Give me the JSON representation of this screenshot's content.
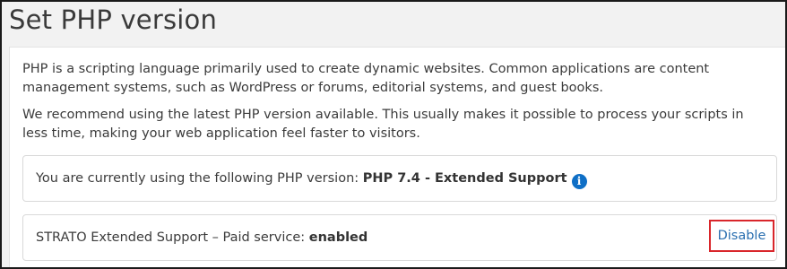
{
  "page": {
    "title": "Set PHP version"
  },
  "intro": {
    "paragraph1": "PHP is a scripting language primarily used to create dynamic websites. Common applications are content management systems, such as WordPress or forums, editorial systems, and guest books.",
    "paragraph2": "We recommend using the latest PHP version available. This usually makes it possible to process your scripts in less time, making your web application feel faster to visitors."
  },
  "current_version": {
    "label": "You are currently using the following PHP version: ",
    "value": "PHP 7.4 - Extended Support",
    "info_icon": "info-icon",
    "info_glyph": "i"
  },
  "extended_support": {
    "label": "STRATO Extended Support – Paid service: ",
    "status": "enabled",
    "action_label": "Disable"
  },
  "colors": {
    "accent": "#0f6fc6",
    "link": "#2a6fb0",
    "highlight_border": "#d9262b"
  }
}
